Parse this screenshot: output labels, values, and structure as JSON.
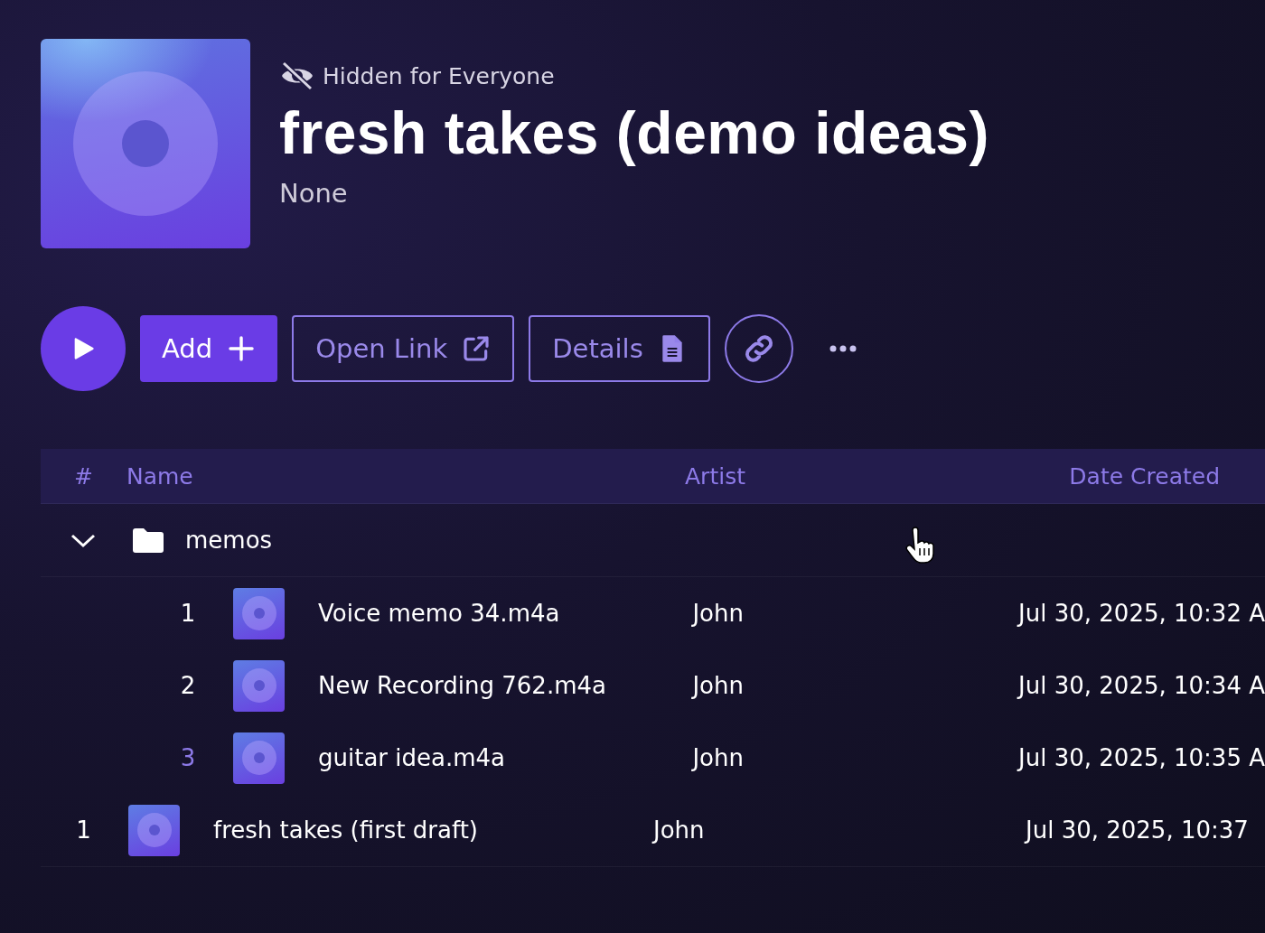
{
  "header": {
    "visibility": "Hidden for Everyone",
    "title": "fresh takes (demo ideas)",
    "subtitle": "None"
  },
  "actions": [
    {
      "kind": "play"
    },
    {
      "kind": "add",
      "label": "Add"
    },
    {
      "kind": "open-link",
      "label": "Open Link"
    },
    {
      "kind": "details",
      "label": "Details"
    },
    {
      "kind": "copy-link"
    },
    {
      "kind": "more"
    }
  ],
  "table": {
    "columns": [
      "#",
      "Name",
      "Artist",
      "Date Created"
    ],
    "rows": [
      {
        "kind": "folder",
        "name": "memos",
        "expanded": true,
        "children": [
          {
            "kind": "track",
            "number": "1",
            "name": "Voice memo 34.m4a",
            "artist": "John",
            "date": "Jul 30, 2025, 10:32 A",
            "highlighted": false
          },
          {
            "kind": "track",
            "number": "2",
            "name": "New Recording 762.m4a",
            "artist": "John",
            "date": "Jul 30, 2025, 10:34 A",
            "highlighted": false
          },
          {
            "kind": "track",
            "number": "3",
            "name": "guitar idea.m4a",
            "artist": "John",
            "date": "Jul 30, 2025, 10:35 A",
            "highlighted": true
          }
        ]
      },
      {
        "kind": "track",
        "number": "1",
        "name": "fresh takes (first draft)",
        "artist": "John",
        "date": "Jul 30, 2025, 10:37",
        "highlighted": false
      }
    ]
  }
}
